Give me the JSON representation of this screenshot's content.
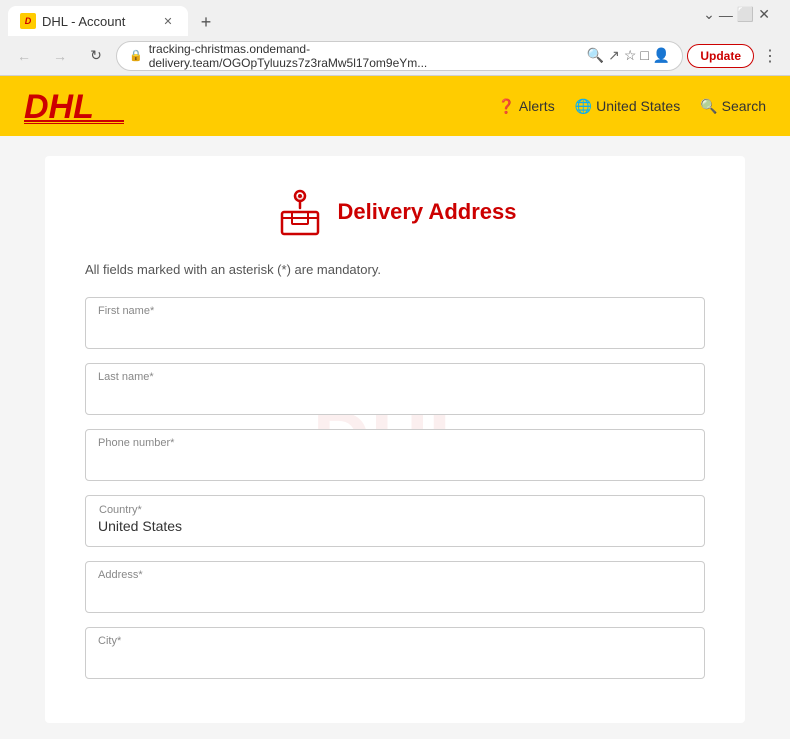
{
  "browser": {
    "tab_title": "DHL - Account",
    "tab_favicon": "DHL",
    "url": "tracking-christmas.ondemand-delivery.team/OGOpTyluuzs7z3raMw5l17om9eYm...",
    "new_tab_label": "+",
    "update_button": "Update",
    "controls": {
      "back": "←",
      "forward": "→",
      "refresh": "↺",
      "home": "⌂"
    }
  },
  "header": {
    "logo_text": "DHL",
    "nav_items": [
      {
        "id": "alerts",
        "icon": "❓",
        "label": "Alerts"
      },
      {
        "id": "country",
        "icon": "🌐",
        "label": "United States"
      },
      {
        "id": "search",
        "icon": "🔍",
        "label": "Search"
      }
    ]
  },
  "form": {
    "icon_alt": "delivery-icon",
    "title": "Delivery Address",
    "mandatory_note": "All fields marked with an asterisk (*) are mandatory.",
    "fields": [
      {
        "id": "first-name",
        "label": "First name*",
        "placeholder": "",
        "value": "",
        "type": "text"
      },
      {
        "id": "last-name",
        "label": "Last name*",
        "placeholder": "",
        "value": "",
        "type": "text"
      },
      {
        "id": "phone",
        "label": "Phone number*",
        "placeholder": "",
        "value": "",
        "type": "text"
      },
      {
        "id": "country",
        "label": "Country*",
        "value": "United States",
        "type": "select"
      },
      {
        "id": "address",
        "label": "Address*",
        "placeholder": "",
        "value": "",
        "type": "text"
      },
      {
        "id": "city",
        "label": "City*",
        "placeholder": "",
        "value": "",
        "type": "text"
      }
    ]
  },
  "colors": {
    "dhl_yellow": "#ffcc00",
    "dhl_red": "#cc0000",
    "border": "#ccc",
    "text_muted": "#888"
  }
}
